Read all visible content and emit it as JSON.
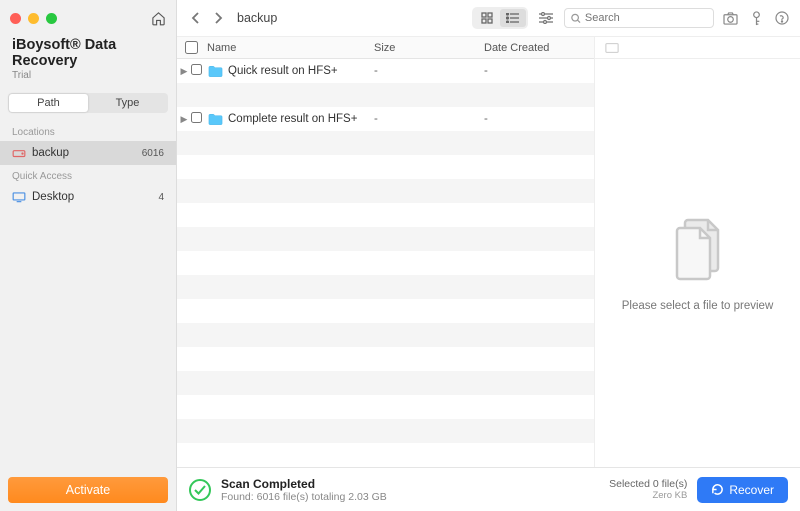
{
  "app": {
    "title": "iBoysoft® Data Recovery",
    "trial": "Trial"
  },
  "sidebar": {
    "tabs": {
      "path": "Path",
      "type": "Type"
    },
    "section_locations": "Locations",
    "section_quick": "Quick Access",
    "items": [
      {
        "label": "backup",
        "count": "6016"
      }
    ],
    "quick_items": [
      {
        "label": "Desktop",
        "count": "4"
      }
    ],
    "activate": "Activate"
  },
  "topbar": {
    "crumb": "backup",
    "search_placeholder": "Search"
  },
  "columns": {
    "name": "Name",
    "size": "Size",
    "date": "Date Created"
  },
  "rows": [
    {
      "name": "Quick result on HFS+",
      "size": "-",
      "date": "-"
    },
    {
      "name": "Complete result on HFS+",
      "size": "-",
      "date": "-"
    }
  ],
  "preview": {
    "message": "Please select a file to preview"
  },
  "footer": {
    "status_title": "Scan Completed",
    "status_detail": "Found: 6016 file(s) totaling 2.03 GB",
    "selected_line1": "Selected 0 file(s)",
    "selected_line2": "Zero KB",
    "recover": "Recover"
  }
}
